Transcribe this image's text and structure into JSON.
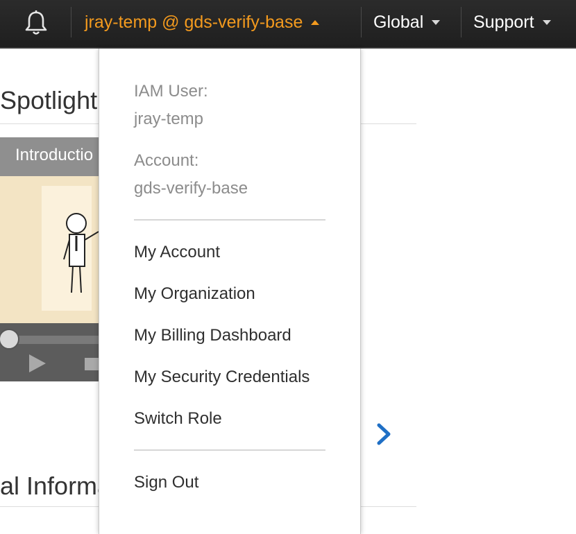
{
  "nav": {
    "bell_icon": "bell-icon",
    "user_account_label": "jray-temp @ gds-verify-base",
    "region_label": "Global",
    "support_label": "Support",
    "accent_color": "#f39a1e"
  },
  "background": {
    "section_title": "Spotlight",
    "video_title": "Introductio",
    "section_title_2": "al Informa"
  },
  "menu": {
    "iam_user_label": "IAM User:",
    "iam_user_value": "jray-temp",
    "account_label": "Account:",
    "account_value": "gds-verify-base",
    "items": [
      {
        "label": "My Account"
      },
      {
        "label": "My Organization"
      },
      {
        "label": "My Billing Dashboard"
      },
      {
        "label": "My Security Credentials"
      },
      {
        "label": "Switch Role"
      }
    ],
    "sign_out_label": "Sign Out"
  }
}
